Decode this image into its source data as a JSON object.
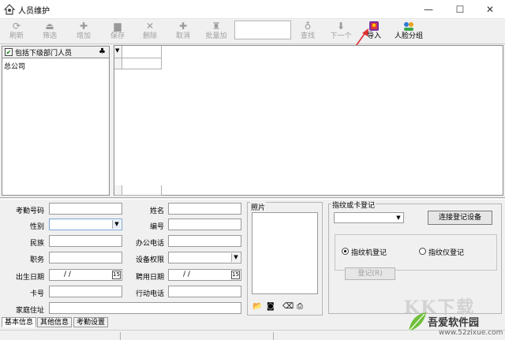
{
  "window": {
    "title": "人员维护",
    "minimize": "—",
    "maximize": "☐",
    "close": "✕"
  },
  "toolbar": {
    "refresh": {
      "label": "刷新",
      "icon": "refresh-icon"
    },
    "filter": {
      "label": "筛选",
      "icon": "filter-icon"
    },
    "add": {
      "label": "增加",
      "icon": "plus-icon"
    },
    "save": {
      "label": "保存",
      "icon": "save-icon"
    },
    "delete": {
      "label": "删除",
      "icon": "x-icon"
    },
    "cancel": {
      "label": "取消",
      "icon": "plus-icon"
    },
    "batch_add": {
      "label": "批量加",
      "icon": "batch-add-icon"
    },
    "search": {
      "label": "查找",
      "icon": "locate-icon"
    },
    "next": {
      "label": "下一个",
      "icon": "down-arrow-icon"
    },
    "import": {
      "label": "导入",
      "icon": "import-icon"
    },
    "face_group": {
      "label": "人脸分组",
      "icon": "face-group-icon"
    },
    "search_value": ""
  },
  "left": {
    "include_sub_label": "包括下级部门人员",
    "include_sub_checked": true,
    "tree_items": [
      "总公司"
    ]
  },
  "form": {
    "attendance_no": "考勤号码",
    "name": "姓名",
    "gender": "性别",
    "number": "编号",
    "ethnicity": "民族",
    "office_phone": "办公电话",
    "title": "职务",
    "device_permission": "设备权限",
    "birth_date": "出生日期",
    "birth_date_value": "/ /",
    "hire_date": "聘用日期",
    "hire_date_value": "/ /",
    "card_no": "卡号",
    "mobile": "行动电话",
    "address": "家庭住址"
  },
  "photo": {
    "title": "照片",
    "tools": [
      "open-folder-icon",
      "camera-icon",
      "eraser-icon",
      "scan-icon"
    ]
  },
  "fingerprint": {
    "title": "指纹或卡登记",
    "connect_button": "连接登记设备",
    "option_machine": "指纹机登记",
    "option_reader": "指纹仪登记",
    "selected": "指纹机登记",
    "register_button": "登记(R)"
  },
  "tabs": [
    "基本信息",
    "其他信息",
    "考勤设置"
  ],
  "watermark": {
    "logo": "KK下载",
    "text": "吾爱软件园",
    "url": "www.52zixue.com"
  },
  "colors": {
    "import_icon_red": "#e03a3a",
    "annotation_arrow": "#e03030",
    "check_green": "#0a7a0a"
  }
}
